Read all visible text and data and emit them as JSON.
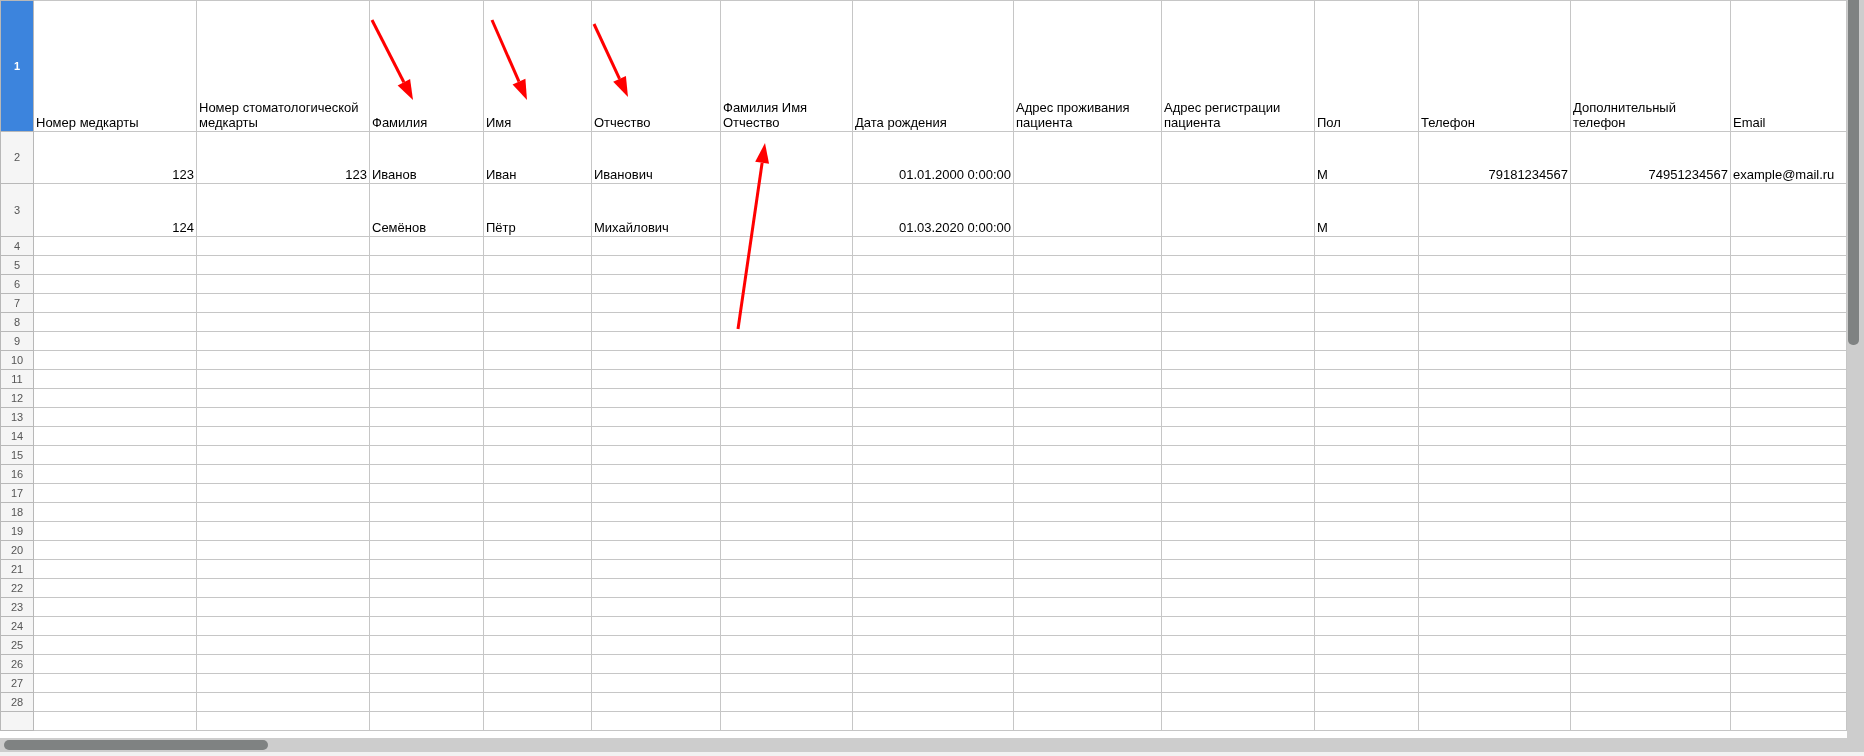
{
  "rows": [
    {
      "number": "1",
      "selected": true,
      "cells": [
        {
          "kind": "text",
          "text": "Номер медкарты"
        },
        {
          "kind": "text",
          "text": "Номер стоматологической медкарты"
        },
        {
          "kind": "text",
          "text": "Фамилия"
        },
        {
          "kind": "text",
          "text": "Имя"
        },
        {
          "kind": "text",
          "text": "Отчество"
        },
        {
          "kind": "text",
          "text": "Фамилия Имя Отчество"
        },
        {
          "kind": "text",
          "text": "Дата рождения"
        },
        {
          "kind": "text",
          "text": "Адрес проживания пациента"
        },
        {
          "kind": "text",
          "text": "Адрес регистрации пациента"
        },
        {
          "kind": "text",
          "text": "Пол"
        },
        {
          "kind": "text",
          "text": "Телефон"
        },
        {
          "kind": "text",
          "text": "Дополнительный телефон"
        },
        {
          "kind": "text",
          "text": "Email"
        }
      ]
    },
    {
      "number": "2",
      "selected": false,
      "cells": [
        {
          "kind": "number",
          "text": "123"
        },
        {
          "kind": "number",
          "text": "123"
        },
        {
          "kind": "text",
          "text": "Иванов"
        },
        {
          "kind": "text",
          "text": "Иван"
        },
        {
          "kind": "text",
          "text": "Иванович"
        },
        {
          "kind": "empty"
        },
        {
          "kind": "number",
          "text": "01.01.2000 0:00:00"
        },
        {
          "kind": "empty"
        },
        {
          "kind": "empty"
        },
        {
          "kind": "text",
          "text": "М"
        },
        {
          "kind": "number",
          "text": "79181234567"
        },
        {
          "kind": "number",
          "text": "74951234567"
        },
        {
          "kind": "text",
          "text": "example@mail.ru"
        }
      ]
    },
    {
      "number": "3",
      "selected": false,
      "cells": [
        {
          "kind": "number",
          "text": "124"
        },
        {
          "kind": "empty"
        },
        {
          "kind": "text",
          "text": "Семёнов"
        },
        {
          "kind": "text",
          "text": "Пётр"
        },
        {
          "kind": "text",
          "text": "Михайлович"
        },
        {
          "kind": "empty"
        },
        {
          "kind": "number",
          "text": "01.03.2020 0:00:00"
        },
        {
          "kind": "empty"
        },
        {
          "kind": "empty"
        },
        {
          "kind": "text",
          "text": "М"
        },
        {
          "kind": "empty"
        },
        {
          "kind": "empty"
        },
        {
          "kind": "empty"
        }
      ]
    },
    {
      "number": "4",
      "selected": false
    },
    {
      "number": "5",
      "selected": false
    },
    {
      "number": "6",
      "selected": false
    },
    {
      "number": "7",
      "selected": false
    },
    {
      "number": "8",
      "selected": false
    },
    {
      "number": "9",
      "selected": false
    },
    {
      "number": "10",
      "selected": false
    },
    {
      "number": "11",
      "selected": false
    },
    {
      "number": "12",
      "selected": false
    },
    {
      "number": "13",
      "selected": false
    },
    {
      "number": "14",
      "selected": false
    },
    {
      "number": "15",
      "selected": false
    },
    {
      "number": "16",
      "selected": false
    },
    {
      "number": "17",
      "selected": false
    },
    {
      "number": "18",
      "selected": false
    },
    {
      "number": "19",
      "selected": false
    },
    {
      "number": "20",
      "selected": false
    },
    {
      "number": "21",
      "selected": false
    },
    {
      "number": "22",
      "selected": false
    },
    {
      "number": "23",
      "selected": false
    },
    {
      "number": "24",
      "selected": false
    },
    {
      "number": "25",
      "selected": false
    },
    {
      "number": "26",
      "selected": false
    },
    {
      "number": "27",
      "selected": false
    },
    {
      "number": "28",
      "selected": false
    }
  ]
}
